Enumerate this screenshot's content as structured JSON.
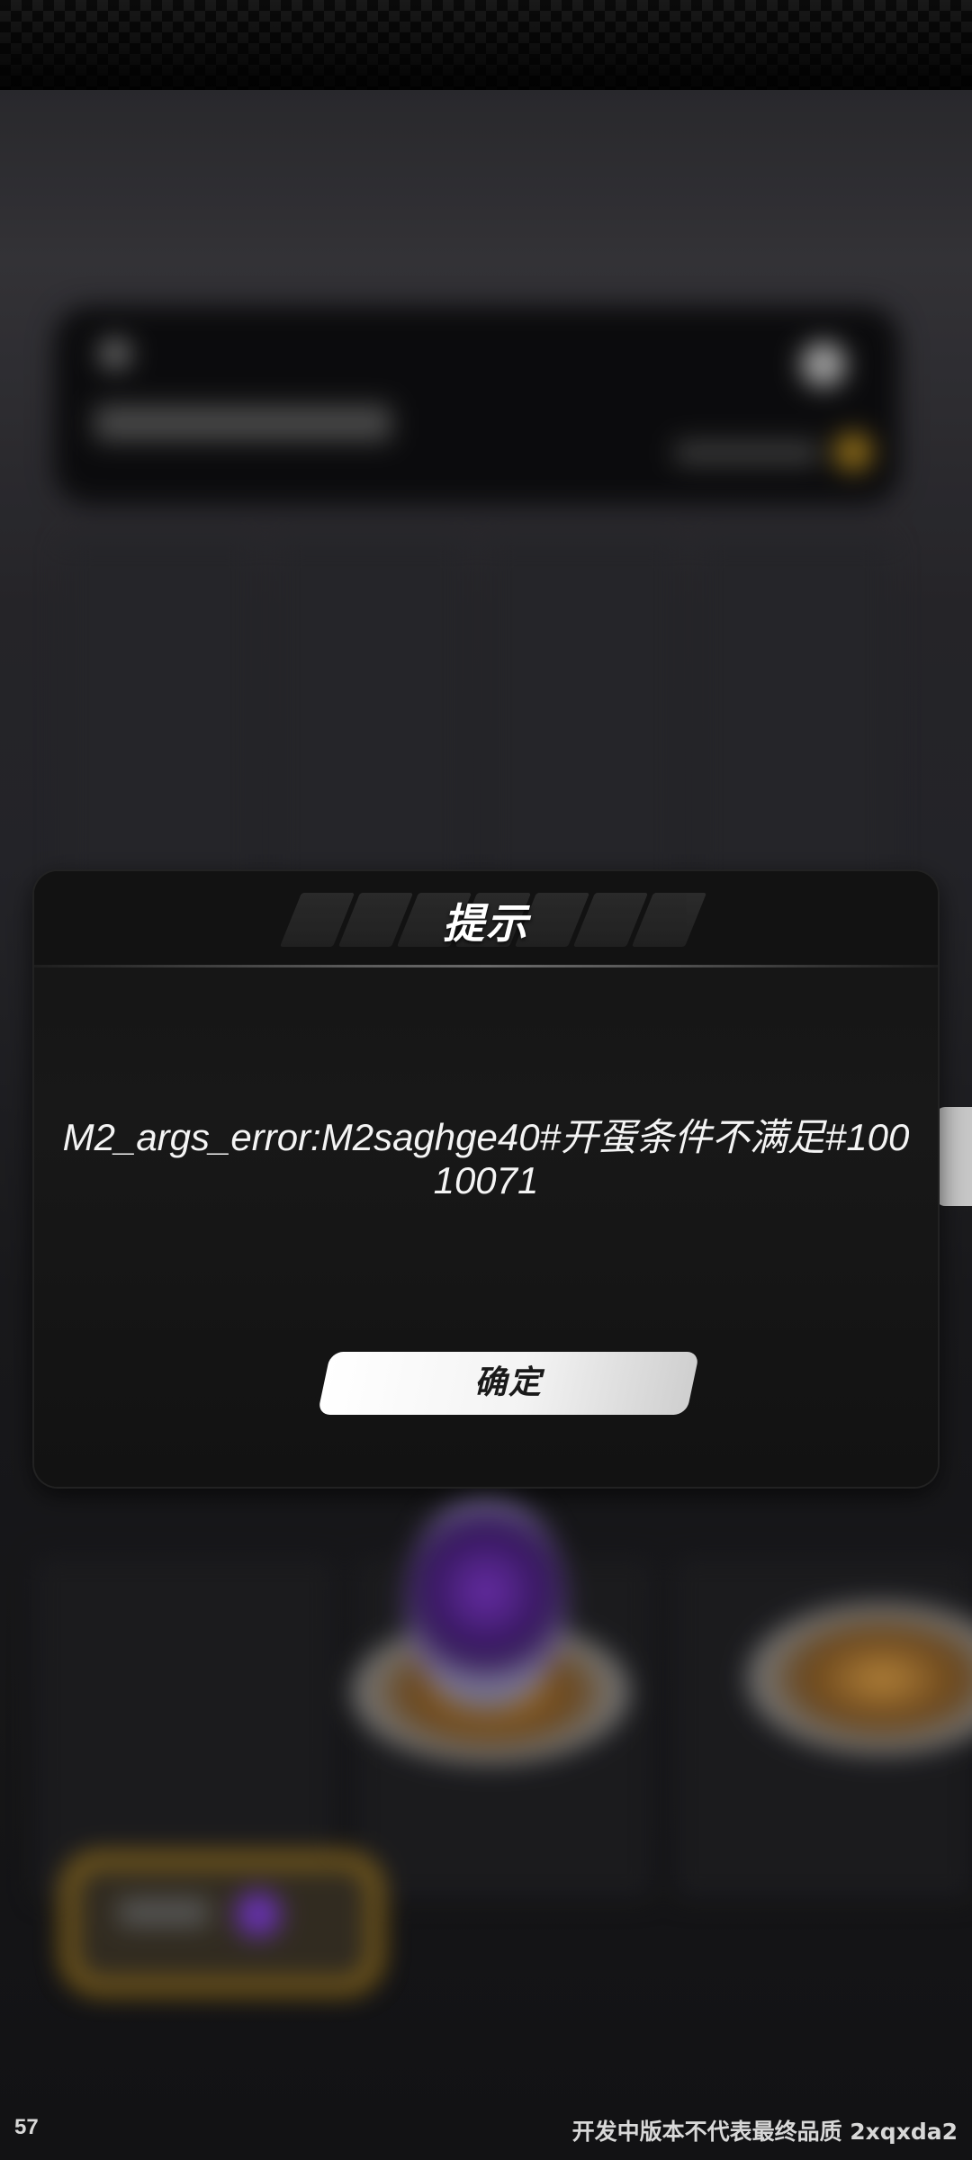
{
  "dialog": {
    "title": "提示",
    "message": "M2_args_error:M2saghge40#开蛋条件不满足#10010071",
    "confirm_label": "确定"
  },
  "footer": {
    "fps": "57",
    "watermark": "开发中版本不代表最终品质 2xqxda2"
  },
  "colors": {
    "dialog_bg": "#141414",
    "button_bg": "#ffffff",
    "egg_accent": "#7a35c4",
    "gold_accent": "#c9951f"
  }
}
